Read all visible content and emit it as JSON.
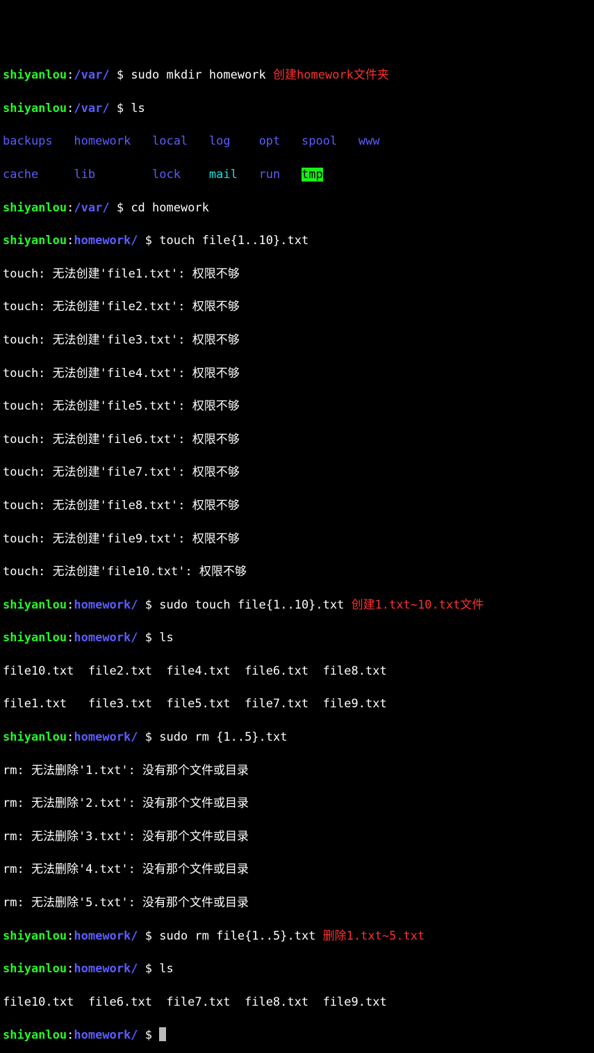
{
  "l1": {
    "user": "shiyanlou",
    "path": "/var/",
    "p": "$",
    "cmd": "sudo mkdir homework",
    "note": "创建homework文件夹"
  },
  "l2": {
    "user": "shiyanlou",
    "path": "/var/",
    "p": "$",
    "cmd": "ls"
  },
  "ls1a": {
    "c1": "backups",
    "c2": "homework",
    "c3": "local",
    "c4": "log",
    "c5": "opt",
    "c6": "spool",
    "c7": "www"
  },
  "ls1b": {
    "c1": "cache",
    "c2": "lib",
    "c3": "lock",
    "c4": "mail",
    "c5": "run",
    "c6": "tmp"
  },
  "l3": {
    "user": "shiyanlou",
    "path": "/var/",
    "p": "$",
    "cmd": "cd homework"
  },
  "l4": {
    "user": "shiyanlou",
    "path": "homework/",
    "p": "$",
    "cmd": "touch file{1..10}.txt"
  },
  "te1": "touch: 无法创建'file1.txt': 权限不够",
  "te2": "touch: 无法创建'file2.txt': 权限不够",
  "te3": "touch: 无法创建'file3.txt': 权限不够",
  "te4": "touch: 无法创建'file4.txt': 权限不够",
  "te5": "touch: 无法创建'file5.txt': 权限不够",
  "te6": "touch: 无法创建'file6.txt': 权限不够",
  "te7": "touch: 无法创建'file7.txt': 权限不够",
  "te8": "touch: 无法创建'file8.txt': 权限不够",
  "te9": "touch: 无法创建'file9.txt': 权限不够",
  "te10": "touch: 无法创建'file10.txt': 权限不够",
  "l5": {
    "user": "shiyanlou",
    "path": "homework/",
    "p": "$",
    "cmd": "sudo touch file{1..10}.txt",
    "note": "创建1.txt~10.txt文件"
  },
  "l6": {
    "user": "shiyanlou",
    "path": "homework/",
    "p": "$",
    "cmd": "ls"
  },
  "ls2a": "file10.txt  file2.txt  file4.txt  file6.txt  file8.txt",
  "ls2b": "file1.txt   file3.txt  file5.txt  file7.txt  file9.txt",
  "l7": {
    "user": "shiyanlou",
    "path": "homework/",
    "p": "$",
    "cmd": "sudo rm {1..5}.txt"
  },
  "re1": "rm: 无法删除'1.txt': 没有那个文件或目录",
  "re2": "rm: 无法删除'2.txt': 没有那个文件或目录",
  "re3": "rm: 无法删除'3.txt': 没有那个文件或目录",
  "re4": "rm: 无法删除'4.txt': 没有那个文件或目录",
  "re5": "rm: 无法删除'5.txt': 没有那个文件或目录",
  "l8": {
    "user": "shiyanlou",
    "path": "homework/",
    "p": "$",
    "cmd": "sudo rm file{1..5}.txt",
    "note": "删除1.txt~5.txt"
  },
  "l9": {
    "user": "shiyanlou",
    "path": "homework/",
    "p": "$",
    "cmd": "ls"
  },
  "ls3": "file10.txt  file6.txt  file7.txt  file8.txt  file9.txt",
  "l10": {
    "user": "shiyanlou",
    "path": "homework/",
    "p": "$",
    "cmd": ""
  }
}
